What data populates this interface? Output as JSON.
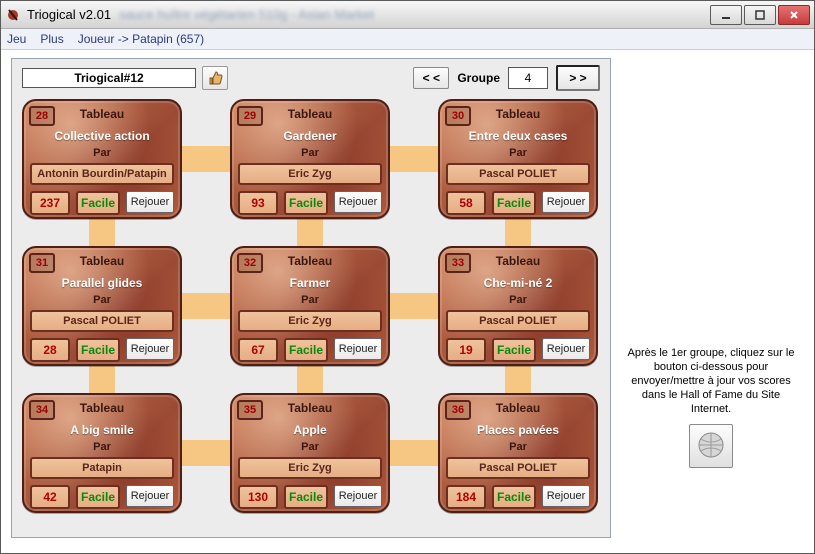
{
  "window": {
    "title": "Triogical v2.01",
    "blurred_subtitle": "sauce huître végétarien 510g - Asian Market",
    "buttons": {
      "min": "minimize",
      "max": "maximize",
      "close": "close"
    }
  },
  "menu": {
    "jeu": "Jeu",
    "plus": "Plus",
    "joueur": "Joueur -> Patapin (657)"
  },
  "panel": {
    "set_name": "Triogical#12",
    "group_label": "Groupe",
    "group_number": "4",
    "nav_prev": "< <",
    "nav_next": "> >"
  },
  "labels": {
    "tableau": "Tableau",
    "par": "Par",
    "replay": "Rejouer"
  },
  "side": {
    "hof_text": "Après le 1er groupe, cliquez sur le bouton ci-dessous pour envoyer/mettre à jour vos scores dans le Hall of Fame du Site Internet."
  },
  "cards": [
    {
      "num": "28",
      "title": "Collective action",
      "author": "Antonin Bourdin/Patapin",
      "score": "237",
      "difficulty": "Facile"
    },
    {
      "num": "29",
      "title": "Gardener",
      "author": "Eric Zyg",
      "score": "93",
      "difficulty": "Facile"
    },
    {
      "num": "30",
      "title": "Entre deux cases",
      "author": "Pascal POLIET",
      "score": "58",
      "difficulty": "Facile"
    },
    {
      "num": "31",
      "title": "Parallel glides",
      "author": "Pascal POLIET",
      "score": "28",
      "difficulty": "Facile"
    },
    {
      "num": "32",
      "title": "Farmer",
      "author": "Eric Zyg",
      "score": "67",
      "difficulty": "Facile"
    },
    {
      "num": "33",
      "title": "Che-mi-né 2",
      "author": "Pascal POLIET",
      "score": "19",
      "difficulty": "Facile"
    },
    {
      "num": "34",
      "title": "A big smile",
      "author": "Patapin",
      "score": "42",
      "difficulty": "Facile"
    },
    {
      "num": "35",
      "title": "Apple",
      "author": "Eric Zyg",
      "score": "130",
      "difficulty": "Facile"
    },
    {
      "num": "36",
      "title": "Places pavées",
      "author": "Pascal POLIET",
      "score": "184",
      "difficulty": "Facile"
    }
  ]
}
